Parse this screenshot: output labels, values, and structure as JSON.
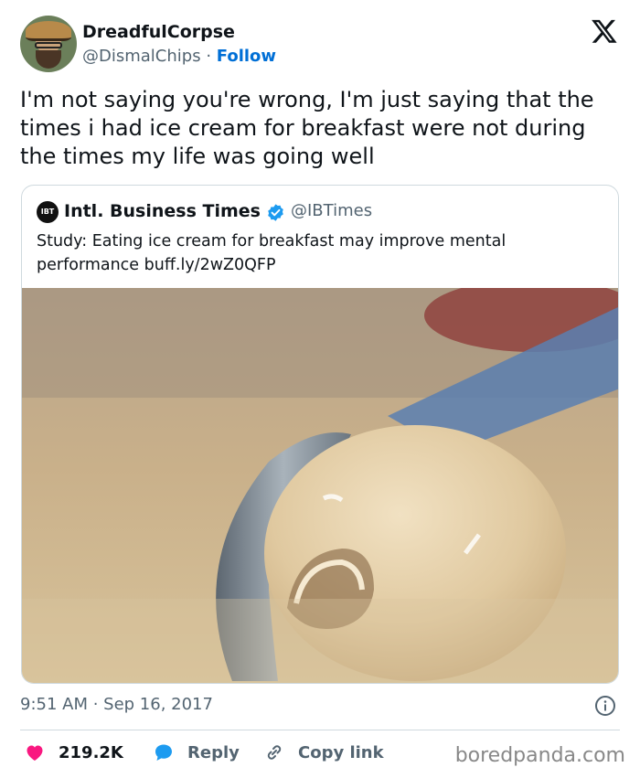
{
  "author": {
    "display_name": "DreadfulCorpse",
    "handle": "@DismalChips",
    "separator": " · ",
    "follow_label": "Follow"
  },
  "platform_icon": "x-logo-icon",
  "tweet": {
    "text": "I'm not saying you're wrong, I'm just saying that the times i had ice cream for breakfast were not during the times my life was going well"
  },
  "quoted_tweet": {
    "logo_text": "IBT",
    "display_name": "Intl. Business Times",
    "verified": true,
    "handle": "@IBTimes",
    "text": "Study: Eating ice cream for breakfast may improve mental performance buff.ly/2wZ0QFP",
    "image_alt": "ice-cream-scoop-photo"
  },
  "meta": {
    "timestamp": "9:51 AM · Sep 16, 2017"
  },
  "actions": {
    "like_count": "219.2K",
    "reply_label": "Reply",
    "copy_link_label": "Copy link"
  },
  "watermark": "boredpanda.com",
  "colors": {
    "like": "#f91880",
    "reply": "#1d9bf0",
    "link": "#006fd6",
    "muted": "#536471",
    "verified": "#1d9bf0"
  }
}
